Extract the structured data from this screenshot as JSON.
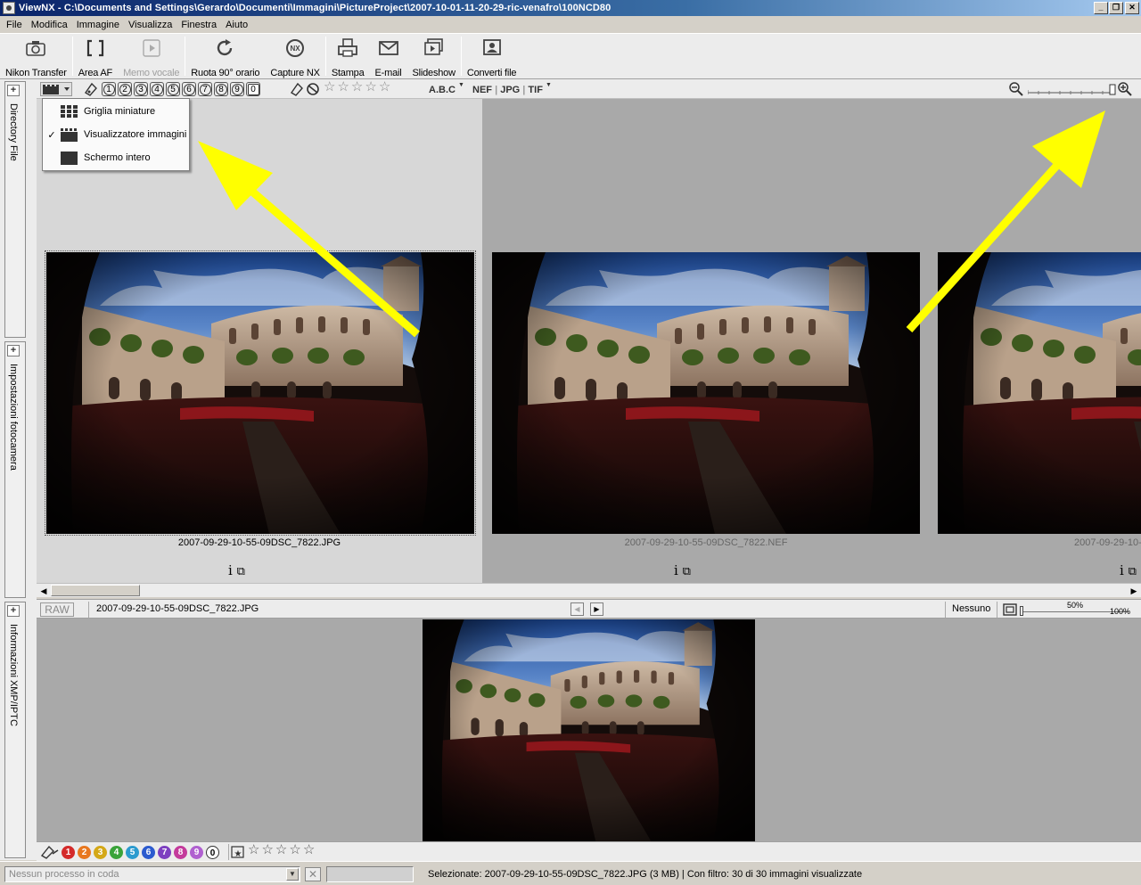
{
  "window": {
    "title": "ViewNX - C:\\Documents and Settings\\Gerardo\\Documenti\\Immagini\\PictureProject\\2007-10-01-11-20-29-ric-venafro\\100NCD80",
    "min_label": "_",
    "max_label": "❐",
    "close_label": "✕"
  },
  "menu": [
    "File",
    "Modifica",
    "Immagine",
    "Visualizza",
    "Finestra",
    "Aiuto"
  ],
  "toolbar": {
    "nikon_transfer": "Nikon Transfer",
    "area_af": "Area AF",
    "memo_vocale": "Memo vocale",
    "ruota": "Ruota 90° orario",
    "capture_nx": "Capture NX",
    "stampa": "Stampa",
    "email": "E-mail",
    "slideshow": "Slideshow",
    "converti": "Converti file"
  },
  "sidebar": {
    "panel1": "Directory File",
    "panel2": "Impostazioni fotocamera",
    "panel3": "Informazioni XMP/IPTC",
    "plus": "+"
  },
  "filterbar": {
    "labels": [
      "1",
      "2",
      "3",
      "4",
      "5",
      "6",
      "7",
      "8",
      "9",
      "0"
    ],
    "stars": [
      "☆",
      "☆",
      "☆",
      "☆",
      "☆"
    ],
    "sort_label": "A.B.C",
    "types": [
      "NEF",
      "JPG",
      "TIF"
    ],
    "zoom_level": 1.0
  },
  "view_menu": {
    "items": [
      {
        "label": "Griglia miniature",
        "checked": false,
        "icon": "grid-icon"
      },
      {
        "label": "Visualizzatore immagini",
        "checked": true,
        "icon": "viewer-icon"
      },
      {
        "label": "Schermo intero",
        "checked": false,
        "icon": "fullscreen-icon"
      }
    ],
    "check_mark": "✓"
  },
  "thumbnails": [
    {
      "filename": "2007-09-29-10-55-09DSC_7822.JPG",
      "selected": true
    },
    {
      "filename": "2007-09-29-10-55-09DSC_7822.NEF",
      "selected": false
    },
    {
      "filename": "2007-09-29-10-",
      "selected": false
    }
  ],
  "cell_icons": {
    "info": "i",
    "compare": "⧉"
  },
  "infobar": {
    "raw": "RAW",
    "filename": "2007-09-29-10-55-09DSC_7822.JPG",
    "prev": "◀",
    "next": "▶",
    "nessuno": "Nessuno",
    "zoom_mid": "50%",
    "zoom_max": "100%"
  },
  "labelbar": {
    "labels": [
      "1",
      "2",
      "3",
      "4",
      "5",
      "6",
      "7",
      "8",
      "9",
      "0"
    ],
    "label_colors": [
      "#d42a2a",
      "#e8771f",
      "#d4a817",
      "#3aa33a",
      "#2c9bcf",
      "#2c5bcf",
      "#7d3fc0",
      "#c43a9c",
      "#b060d0",
      "#ffffff"
    ],
    "stars": [
      "☆",
      "☆",
      "☆",
      "☆",
      "☆"
    ]
  },
  "statusbar": {
    "queue": "Nessun processo in coda",
    "cancel": "✕",
    "status": "Selezionate: 2007-09-29-10-55-09DSC_7822.JPG (3 MB) | Con filtro: 30 di 30 immagini visualizzate"
  },
  "colors": {
    "annotation_arrow": "#ffff00",
    "titlebar_start": "#0a246a"
  }
}
